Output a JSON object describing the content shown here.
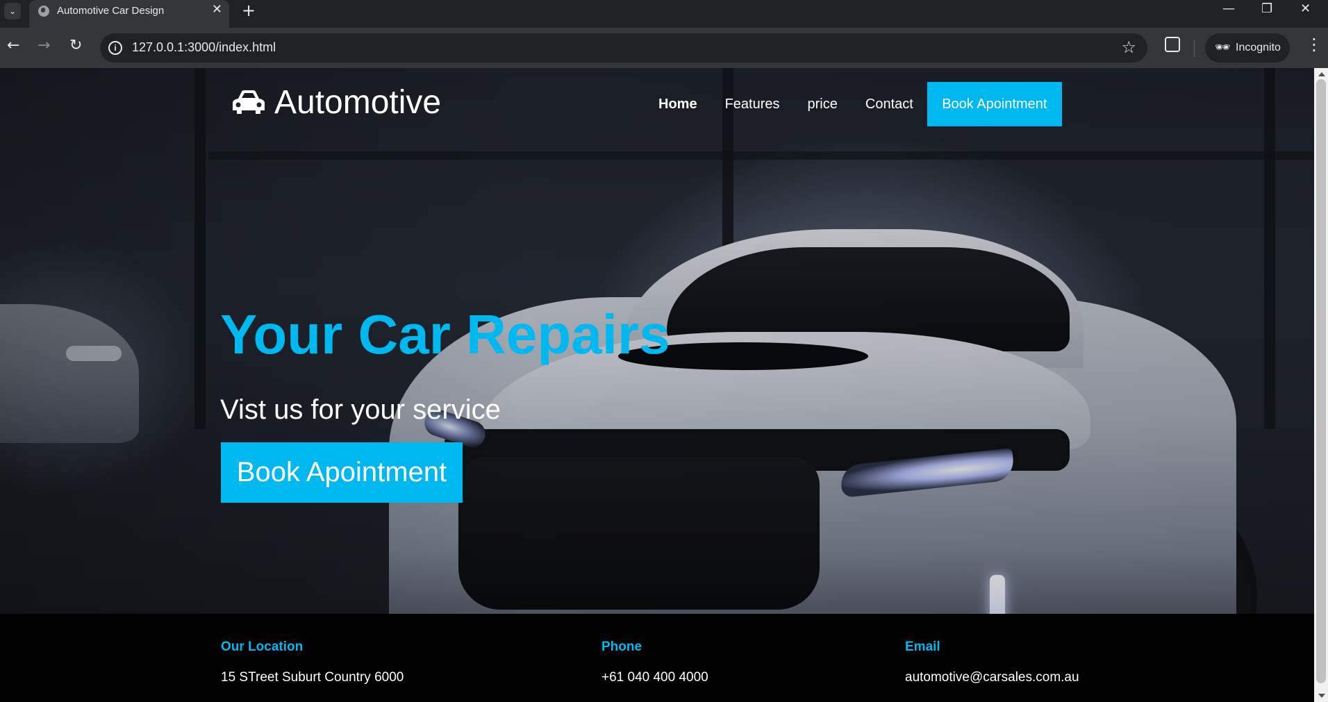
{
  "browser": {
    "tab_title": "Automotive Car Design",
    "url": "127.0.0.1:3000/index.html",
    "incognito_label": "Incognito"
  },
  "site": {
    "brand": "Automotive",
    "nav": {
      "items": [
        "Home",
        "Features",
        "price",
        "Contact"
      ],
      "active": "Home",
      "cta": "Book Apointment"
    },
    "hero": {
      "title": "Your Car Repairs",
      "subtitle": "Vist us for your service",
      "button": "Book Apointment"
    },
    "footer": {
      "location": {
        "label": "Our Location",
        "value": "15 STreet Suburt Country 6000"
      },
      "phone": {
        "label": "Phone",
        "value": "+61 040 400 4000"
      },
      "email": {
        "label": "Email",
        "value": "automotive@carsales.com.au"
      }
    },
    "colors": {
      "accent": "#00b8f0",
      "footer_bg": "#000000",
      "text": "#ffffff"
    }
  }
}
